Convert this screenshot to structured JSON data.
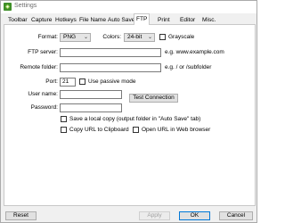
{
  "window": {
    "title": "Settings"
  },
  "icons": {
    "app": "greenshot-app-icon"
  },
  "tabs": [
    {
      "label": "Toolbar"
    },
    {
      "label": "Capture"
    },
    {
      "label": "Hotkeys"
    },
    {
      "label": "File Name"
    },
    {
      "label": "Auto Save"
    },
    {
      "label": "FTP",
      "active": true
    },
    {
      "label": "Print"
    },
    {
      "label": "Editor"
    },
    {
      "label": "Misc."
    }
  ],
  "ftp": {
    "format_label": "Format:",
    "format_value": "PNG",
    "colors_label": "Colors:",
    "colors_value": "24-bit",
    "grayscale_label": "Grayscale",
    "server_label": "FTP server:",
    "server_value": "",
    "server_hint": "e.g. www.example.com",
    "folder_label": "Remote folder:",
    "folder_value": "",
    "folder_hint": "e.g. / or /subfolder",
    "port_label": "Port:",
    "port_value": "21",
    "passive_label": "Use passive mode",
    "user_label": "User name:",
    "user_value": "",
    "test_button": "Test Connection",
    "password_label": "Password:",
    "password_value": "",
    "save_local_label": "Save a local copy (output folder in \"Auto Save\" tab)",
    "copy_url_label": "Copy URL to Clipboard",
    "open_url_label": "Open URL in Web browser"
  },
  "footer": {
    "reset": "Reset",
    "apply": "Apply",
    "ok": "OK",
    "cancel": "Cancel"
  }
}
